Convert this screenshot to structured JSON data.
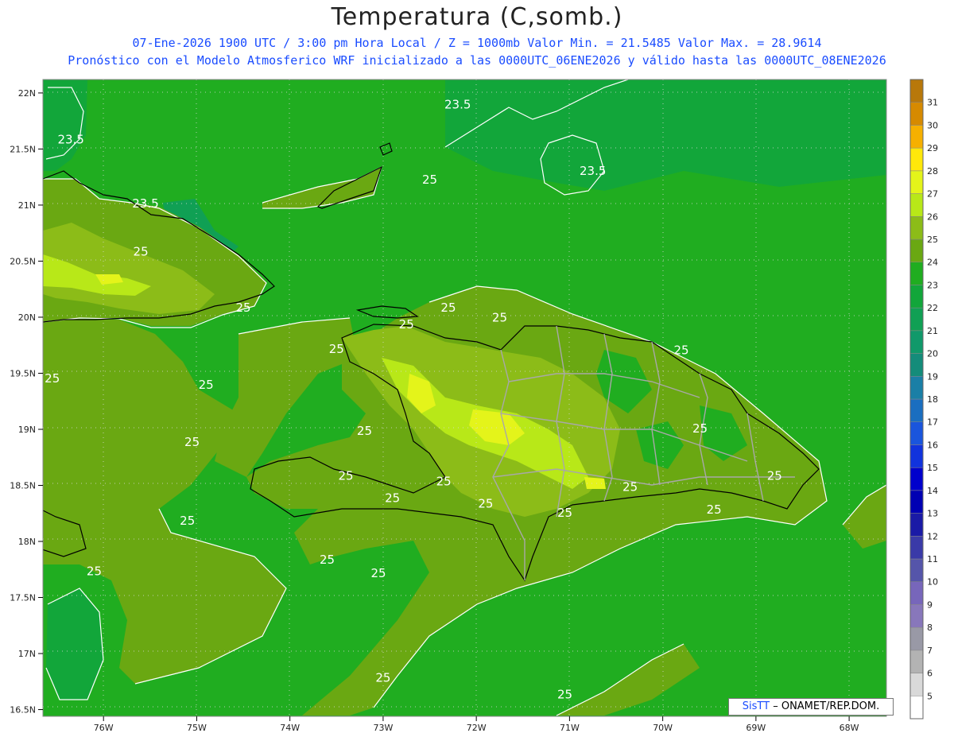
{
  "header": {
    "title": "Temperatura (C,somb.)",
    "line1": "07-Ene-2026  1900 UTC / 3:00 pm Hora Local / Z = 1000mb   Valor Min. = 21.5485  Valor Max. = 28.9614",
    "line2": "Pronóstico con el Modelo Atmosferico WRF inicializado a las 0000UTC_06ENE2026 y válido hasta las  0000UTC_08ENE2026"
  },
  "axes": {
    "lat_labels": [
      "22N",
      "21.5N",
      "21N",
      "20.5N",
      "20N",
      "19.5N",
      "19N",
      "18.5N",
      "18N",
      "17.5N",
      "17N",
      "16.5N"
    ],
    "lon_labels": [
      "76W",
      "75W",
      "74W",
      "73W",
      "72W",
      "71W",
      "70W",
      "69W",
      "68W"
    ]
  },
  "contour_labels": [
    {
      "text": "23.5",
      "lon": -76.35,
      "lat": 21.55
    },
    {
      "text": "23.5",
      "lon": -75.55,
      "lat": 20.98
    },
    {
      "text": "23.5",
      "lon": -72.2,
      "lat": 21.86
    },
    {
      "text": "23.5",
      "lon": -70.75,
      "lat": 21.27
    },
    {
      "text": "25",
      "lon": -72.5,
      "lat": 21.19
    },
    {
      "text": "25",
      "lon": -75.6,
      "lat": 20.55
    },
    {
      "text": "25",
      "lon": -74.5,
      "lat": 20.05
    },
    {
      "text": "25",
      "lon": -73.5,
      "lat": 19.68
    },
    {
      "text": "25",
      "lon": -72.75,
      "lat": 19.9
    },
    {
      "text": "25",
      "lon": -72.3,
      "lat": 20.05
    },
    {
      "text": "25",
      "lon": -71.75,
      "lat": 19.96
    },
    {
      "text": "25",
      "lon": -74.9,
      "lat": 19.36
    },
    {
      "text": "25",
      "lon": -76.55,
      "lat": 19.42
    },
    {
      "text": "25",
      "lon": -75.05,
      "lat": 18.85
    },
    {
      "text": "25",
      "lon": -73.2,
      "lat": 18.95
    },
    {
      "text": "25",
      "lon": -73.4,
      "lat": 18.55
    },
    {
      "text": "25",
      "lon": -72.9,
      "lat": 18.35
    },
    {
      "text": "25",
      "lon": -72.35,
      "lat": 18.5
    },
    {
      "text": "25",
      "lon": -71.9,
      "lat": 18.3
    },
    {
      "text": "25",
      "lon": -71.05,
      "lat": 18.22
    },
    {
      "text": "25",
      "lon": -70.35,
      "lat": 18.45
    },
    {
      "text": "25",
      "lon": -69.6,
      "lat": 18.97
    },
    {
      "text": "25",
      "lon": -68.8,
      "lat": 18.55
    },
    {
      "text": "25",
      "lon": -69.8,
      "lat": 19.67
    },
    {
      "text": "25",
      "lon": -69.45,
      "lat": 18.25
    },
    {
      "text": "25",
      "lon": -75.1,
      "lat": 18.15
    },
    {
      "text": "25",
      "lon": -73.6,
      "lat": 17.8
    },
    {
      "text": "25",
      "lon": -73.05,
      "lat": 17.68
    },
    {
      "text": "25",
      "lon": -76.1,
      "lat": 17.7
    },
    {
      "text": "25",
      "lon": -73.0,
      "lat": 16.75
    },
    {
      "text": "25",
      "lon": -71.05,
      "lat": 16.6
    }
  ],
  "colorbar": {
    "levels": [
      "5",
      "6",
      "7",
      "8",
      "9",
      "10",
      "11",
      "12",
      "13",
      "14",
      "15",
      "16",
      "17",
      "18",
      "19",
      "20",
      "21",
      "22",
      "23",
      "24",
      "25",
      "26",
      "27",
      "28",
      "29",
      "30",
      "31"
    ],
    "colors": [
      "#ffffff",
      "#d9d9d9",
      "#b3b3b3",
      "#9999a6",
      "#8877bb",
      "#7766bb",
      "#5555aa",
      "#3a3aa8",
      "#1a1aa6",
      "#0000b3",
      "#0000cc",
      "#1133dd",
      "#1a55dd",
      "#1a6ec0",
      "#1a7fa6",
      "#148c7a",
      "#10996a",
      "#10a054",
      "#12a63a",
      "#20ad20",
      "#6aa812",
      "#8cbc18",
      "#b8e818",
      "#e4f41a",
      "#ffe80a",
      "#f6b000",
      "#d68a00",
      "#b8780a"
    ]
  },
  "credit": {
    "brand": "SisTT",
    "org": "– ONAMET/REP.DOM."
  }
}
